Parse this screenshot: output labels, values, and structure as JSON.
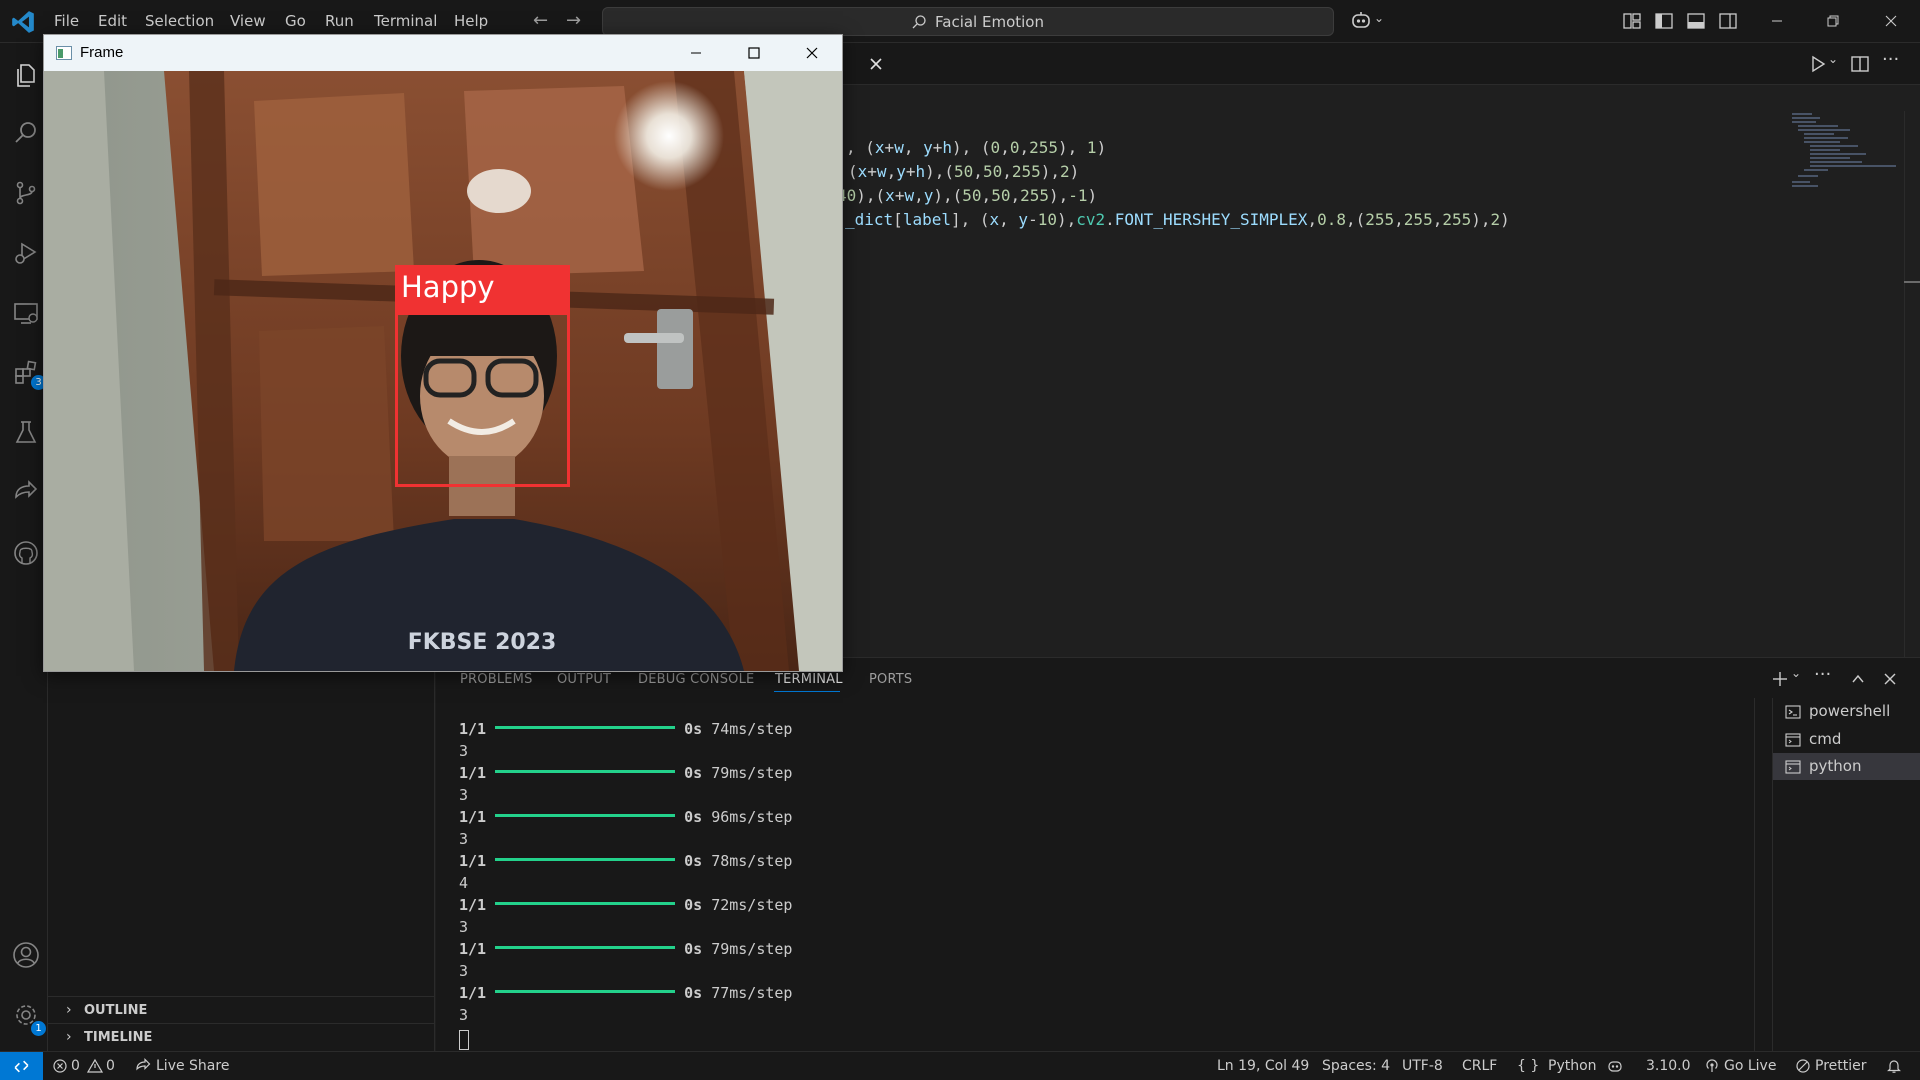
{
  "titlebar": {
    "menu": [
      "File",
      "Edit",
      "Selection",
      "View",
      "Go",
      "Run",
      "Terminal",
      "Help"
    ],
    "search_text": "Facial Emotion"
  },
  "activity_bar": {
    "icons": [
      "explorer-icon",
      "search-icon",
      "source-control-icon",
      "run-debug-icon",
      "remote-explorer-icon",
      "extensions-icon",
      "testing-icon",
      "live-share-icon",
      "github-icon",
      "account-icon",
      "settings-icon"
    ],
    "extensions_badge": "3",
    "settings_badge": "1"
  },
  "sidebar": {
    "outline_label": "OUTLINE",
    "timeline_label": "TIMELINE"
  },
  "editor": {
    "code_lines": [
      [
        {
          "t": ", (",
          "c": "def"
        },
        {
          "t": "x",
          "c": "var"
        },
        {
          "t": "+",
          "c": "def"
        },
        {
          "t": "w",
          "c": "var"
        },
        {
          "t": ", ",
          "c": "def"
        },
        {
          "t": "y",
          "c": "var"
        },
        {
          "t": "+",
          "c": "def"
        },
        {
          "t": "h",
          "c": "var"
        },
        {
          "t": "), (",
          "c": "def"
        },
        {
          "t": "0",
          "c": "num"
        },
        {
          "t": ",",
          "c": "def"
        },
        {
          "t": "0",
          "c": "num"
        },
        {
          "t": ",",
          "c": "def"
        },
        {
          "t": "255",
          "c": "num"
        },
        {
          "t": "), ",
          "c": "def"
        },
        {
          "t": "1",
          "c": "num"
        },
        {
          "t": ")",
          "c": "def"
        }
      ],
      [
        {
          "t": "(",
          "c": "def"
        },
        {
          "t": "x",
          "c": "var"
        },
        {
          "t": "+",
          "c": "def"
        },
        {
          "t": "w",
          "c": "var"
        },
        {
          "t": ",",
          "c": "def"
        },
        {
          "t": "y",
          "c": "var"
        },
        {
          "t": "+",
          "c": "def"
        },
        {
          "t": "h",
          "c": "var"
        },
        {
          "t": "),(",
          "c": "def"
        },
        {
          "t": "50",
          "c": "num"
        },
        {
          "t": ",",
          "c": "def"
        },
        {
          "t": "50",
          "c": "num"
        },
        {
          "t": ",",
          "c": "def"
        },
        {
          "t": "255",
          "c": "num"
        },
        {
          "t": "),",
          "c": "def"
        },
        {
          "t": "2",
          "c": "num"
        },
        {
          "t": ")",
          "c": "def"
        }
      ],
      [
        {
          "t": "40",
          "c": "num"
        },
        {
          "t": "),(",
          "c": "def"
        },
        {
          "t": "x",
          "c": "var"
        },
        {
          "t": "+",
          "c": "def"
        },
        {
          "t": "w",
          "c": "var"
        },
        {
          "t": ",",
          "c": "def"
        },
        {
          "t": "y",
          "c": "var"
        },
        {
          "t": "),(",
          "c": "def"
        },
        {
          "t": "50",
          "c": "num"
        },
        {
          "t": ",",
          "c": "def"
        },
        {
          "t": "50",
          "c": "num"
        },
        {
          "t": ",",
          "c": "def"
        },
        {
          "t": "255",
          "c": "num"
        },
        {
          "t": "),",
          "c": "def"
        },
        {
          "t": "-1",
          "c": "num"
        },
        {
          "t": ")",
          "c": "def"
        }
      ],
      [
        {
          "t": "_dict",
          "c": "var"
        },
        {
          "t": "[",
          "c": "def"
        },
        {
          "t": "label",
          "c": "var"
        },
        {
          "t": "], (",
          "c": "def"
        },
        {
          "t": "x",
          "c": "var"
        },
        {
          "t": ", ",
          "c": "def"
        },
        {
          "t": "y",
          "c": "var"
        },
        {
          "t": "-",
          "c": "def"
        },
        {
          "t": "10",
          "c": "num"
        },
        {
          "t": "),",
          "c": "def"
        },
        {
          "t": "cv2",
          "c": "cls"
        },
        {
          "t": ".",
          "c": "def"
        },
        {
          "t": "FONT_HERSHEY_SIMPLEX",
          "c": "var"
        },
        {
          "t": ",",
          "c": "def"
        },
        {
          "t": "0.8",
          "c": "num"
        },
        {
          "t": ",(",
          "c": "def"
        },
        {
          "t": "255",
          "c": "num"
        },
        {
          "t": ",",
          "c": "def"
        },
        {
          "t": "255",
          "c": "num"
        },
        {
          "t": ",",
          "c": "def"
        },
        {
          "t": "255",
          "c": "num"
        },
        {
          "t": "),",
          "c": "def"
        },
        {
          "t": "2",
          "c": "num"
        },
        {
          "t": ")",
          "c": "def"
        }
      ]
    ]
  },
  "panel": {
    "tabs": [
      "PROBLEMS",
      "OUTPUT",
      "DEBUG CONSOLE",
      "TERMINAL",
      "PORTS"
    ],
    "active_tab": "TERMINAL",
    "terminal_output": [
      {
        "step": "1/1",
        "time": "0s",
        "rate": "74ms/step",
        "result": "3"
      },
      {
        "step": "1/1",
        "time": "0s",
        "rate": "79ms/step",
        "result": "3"
      },
      {
        "step": "1/1",
        "time": "0s",
        "rate": "96ms/step",
        "result": "3"
      },
      {
        "step": "1/1",
        "time": "0s",
        "rate": "78ms/step",
        "result": "4"
      },
      {
        "step": "1/1",
        "time": "0s",
        "rate": "72ms/step",
        "result": "3"
      },
      {
        "step": "1/1",
        "time": "0s",
        "rate": "79ms/step",
        "result": "3"
      },
      {
        "step": "1/1",
        "time": "0s",
        "rate": "77ms/step",
        "result": "3"
      }
    ],
    "progress_fraction": 1.0,
    "terminals": [
      {
        "label": "powershell",
        "icon": "powershell-icon"
      },
      {
        "label": "cmd",
        "icon": "cmd-icon"
      },
      {
        "label": "python",
        "icon": "cmd-icon"
      }
    ],
    "active_terminal": "python"
  },
  "statusbar": {
    "errors": "0",
    "warnings": "0",
    "live_share": "Live Share",
    "position": "Ln 19, Col 49",
    "spaces": "Spaces: 4",
    "encoding": "UTF-8",
    "eol": "CRLF",
    "language": "Python",
    "python_version": "3.10.0",
    "go_live": "Go Live",
    "prettier": "Prettier"
  },
  "frame_window": {
    "title": "Frame",
    "emotion_label": "Happy",
    "shirt_text": "FKBSE 2023"
  },
  "colors": {
    "accent": "#0078d4",
    "box_red": "#f03232",
    "progress_green": "#23d18b"
  }
}
